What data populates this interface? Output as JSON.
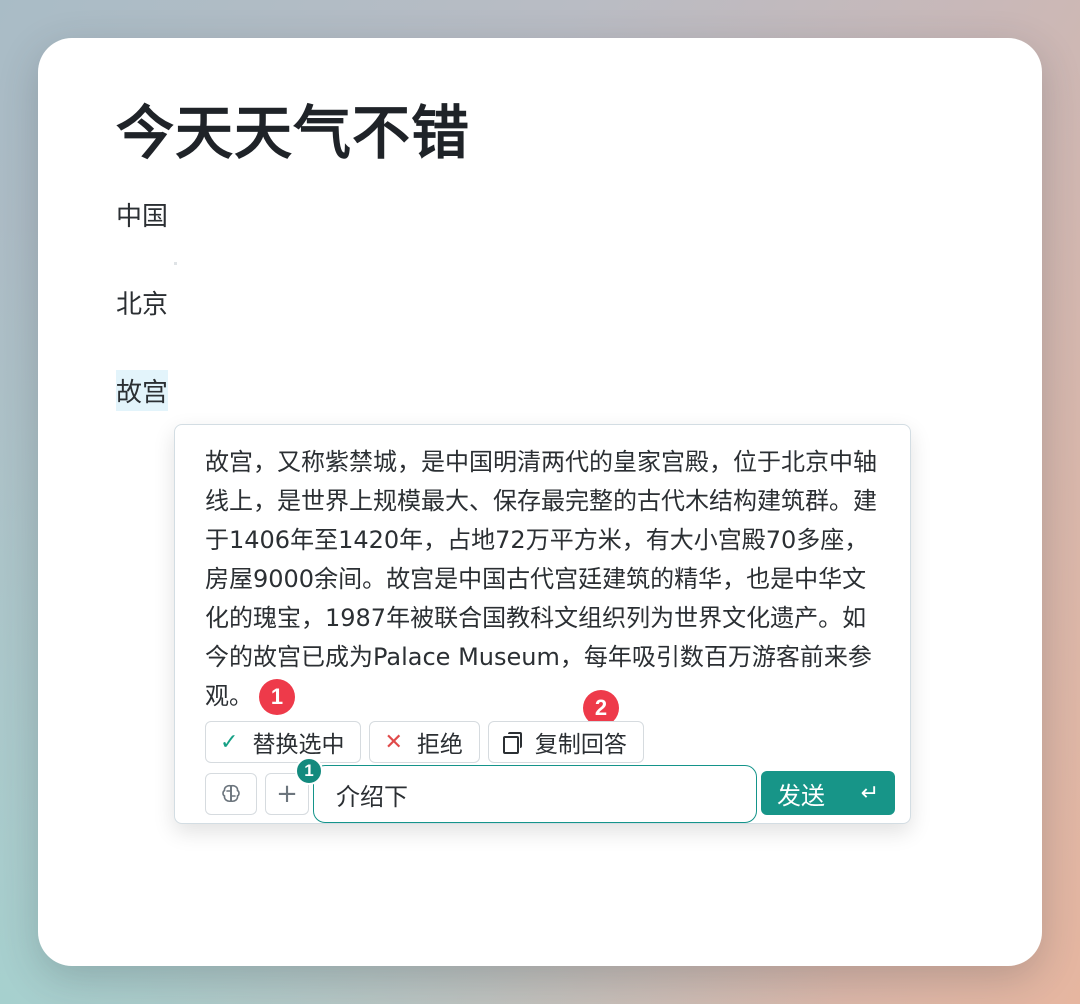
{
  "document": {
    "title": "今天天气不错",
    "paragraphs": [
      "中国",
      "北京",
      "故宫"
    ]
  },
  "ai_panel": {
    "answer": "故宫，又称紫禁城，是中国明清两代的皇家宫殿，位于北京中轴线上，是世界上规模最大、保存最完整的古代木结构建筑群。建于1406年至1420年，占地72万平方米，有大小宫殿70多座，房屋9000余间。故宫是中国古代宫廷建筑的精华，也是中华文化的瑰宝，1987年被联合国教科文组织列为世界文化遗产。如今的故宫已成为Palace Museum，每年吸引数百万游客前来参观。",
    "actions": {
      "replace_label": "替换选中",
      "reject_label": "拒绝",
      "copy_label": "复制回答"
    },
    "markers": [
      "1",
      "2"
    ],
    "input": {
      "value": "介绍下",
      "attachment_count": "1"
    },
    "send_label": "发送",
    "icons": [
      "check-icon",
      "close-icon",
      "copy-icon",
      "brain-icon",
      "plus-icon",
      "enter-icon"
    ],
    "colors": {
      "accent": "#179588",
      "marker": "#ee3a4a",
      "highlight": "#e3f4fb"
    }
  }
}
